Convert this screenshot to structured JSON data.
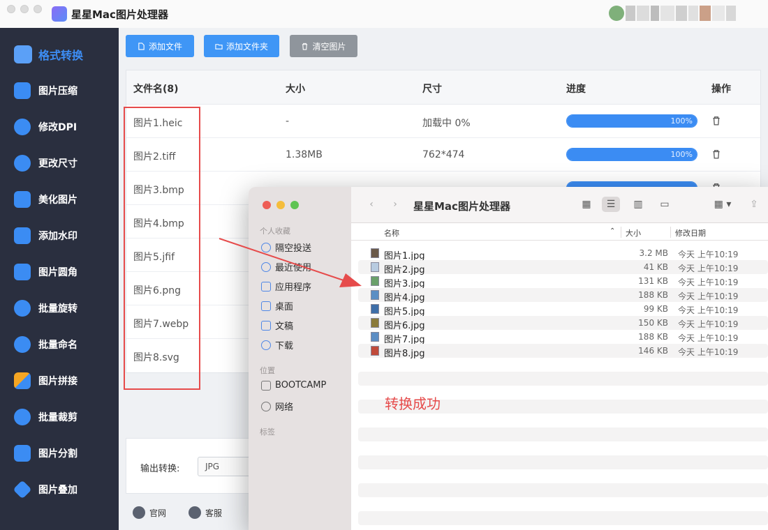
{
  "app": {
    "title": "星星Mac图片处理器"
  },
  "colors": {
    "sidebar_bg": "#2a2f3f",
    "accent_blue": "#3f96f6",
    "highlight_red": "#e64b4b"
  },
  "sidebar": {
    "items": [
      {
        "label": "格式转换",
        "icon": "format-convert-icon",
        "active": true
      },
      {
        "label": "图片压缩",
        "icon": "compress-icon"
      },
      {
        "label": "修改DPI",
        "icon": "dpi-icon"
      },
      {
        "label": "更改尺寸",
        "icon": "resize-icon"
      },
      {
        "label": "美化图片",
        "icon": "beautify-icon"
      },
      {
        "label": "添加水印",
        "icon": "watermark-icon"
      },
      {
        "label": "图片圆角",
        "icon": "round-corner-icon"
      },
      {
        "label": "批量旋转",
        "icon": "rotate-icon"
      },
      {
        "label": "批量命名",
        "icon": "rename-icon"
      },
      {
        "label": "图片拼接",
        "icon": "stitch-icon"
      },
      {
        "label": "批量裁剪",
        "icon": "crop-icon"
      },
      {
        "label": "图片分割",
        "icon": "split-icon"
      },
      {
        "label": "图片叠加",
        "icon": "layers-icon"
      }
    ]
  },
  "toolbar": {
    "add_file": "添加文件",
    "add_folder": "添加文件夹",
    "clear": "清空图片"
  },
  "table": {
    "headers": [
      "文件名(8)",
      "大小",
      "尺寸",
      "进度",
      "操作"
    ],
    "rows": [
      {
        "name": "图片1.heic",
        "size": "-",
        "dims": "加载中 0%",
        "progress": "100%"
      },
      {
        "name": "图片2.tiff",
        "size": "1.38MB",
        "dims": "762*474",
        "progress": "100%"
      },
      {
        "name": "图片3.bmp",
        "size": "",
        "dims": "",
        "progress": ""
      },
      {
        "name": "图片4.bmp",
        "size": "",
        "dims": "",
        "progress": ""
      },
      {
        "name": "图片5.jfif",
        "size": "",
        "dims": "",
        "progress": ""
      },
      {
        "name": "图片6.png",
        "size": "",
        "dims": "",
        "progress": ""
      },
      {
        "name": "图片7.webp",
        "size": "",
        "dims": "",
        "progress": ""
      },
      {
        "name": "图片8.svg",
        "size": "",
        "dims": "",
        "progress": ""
      }
    ]
  },
  "output": {
    "label": "输出转换:",
    "format": "JPG"
  },
  "footer": {
    "website": "官网",
    "support": "客服"
  },
  "finder": {
    "title": "星星Mac图片处理器",
    "sections": {
      "favorites": "个人收藏",
      "locations": "位置",
      "tags": "标签"
    },
    "favorites": [
      "隔空投送",
      "最近使用",
      "应用程序",
      "桌面",
      "文稿",
      "下载"
    ],
    "locations": [
      "BOOTCAMP",
      "网络"
    ],
    "columns": {
      "name": "名称",
      "size": "大小",
      "date": "修改日期"
    },
    "files": [
      {
        "name": "图片1.jpg",
        "size": "3.2 MB",
        "date": "今天 上午10:19"
      },
      {
        "name": "图片2.jpg",
        "size": "41 KB",
        "date": "今天 上午10:19"
      },
      {
        "name": "图片3.jpg",
        "size": "131 KB",
        "date": "今天 上午10:19"
      },
      {
        "name": "图片4.jpg",
        "size": "188 KB",
        "date": "今天 上午10:19"
      },
      {
        "name": "图片5.jpg",
        "size": "99 KB",
        "date": "今天 上午10:19"
      },
      {
        "name": "图片6.jpg",
        "size": "150 KB",
        "date": "今天 上午10:19"
      },
      {
        "name": "图片7.jpg",
        "size": "188 KB",
        "date": "今天 上午10:19"
      },
      {
        "name": "图片8.jpg",
        "size": "146 KB",
        "date": "今天 上午10:19"
      }
    ]
  },
  "annotation": {
    "success_text": "转换成功"
  }
}
